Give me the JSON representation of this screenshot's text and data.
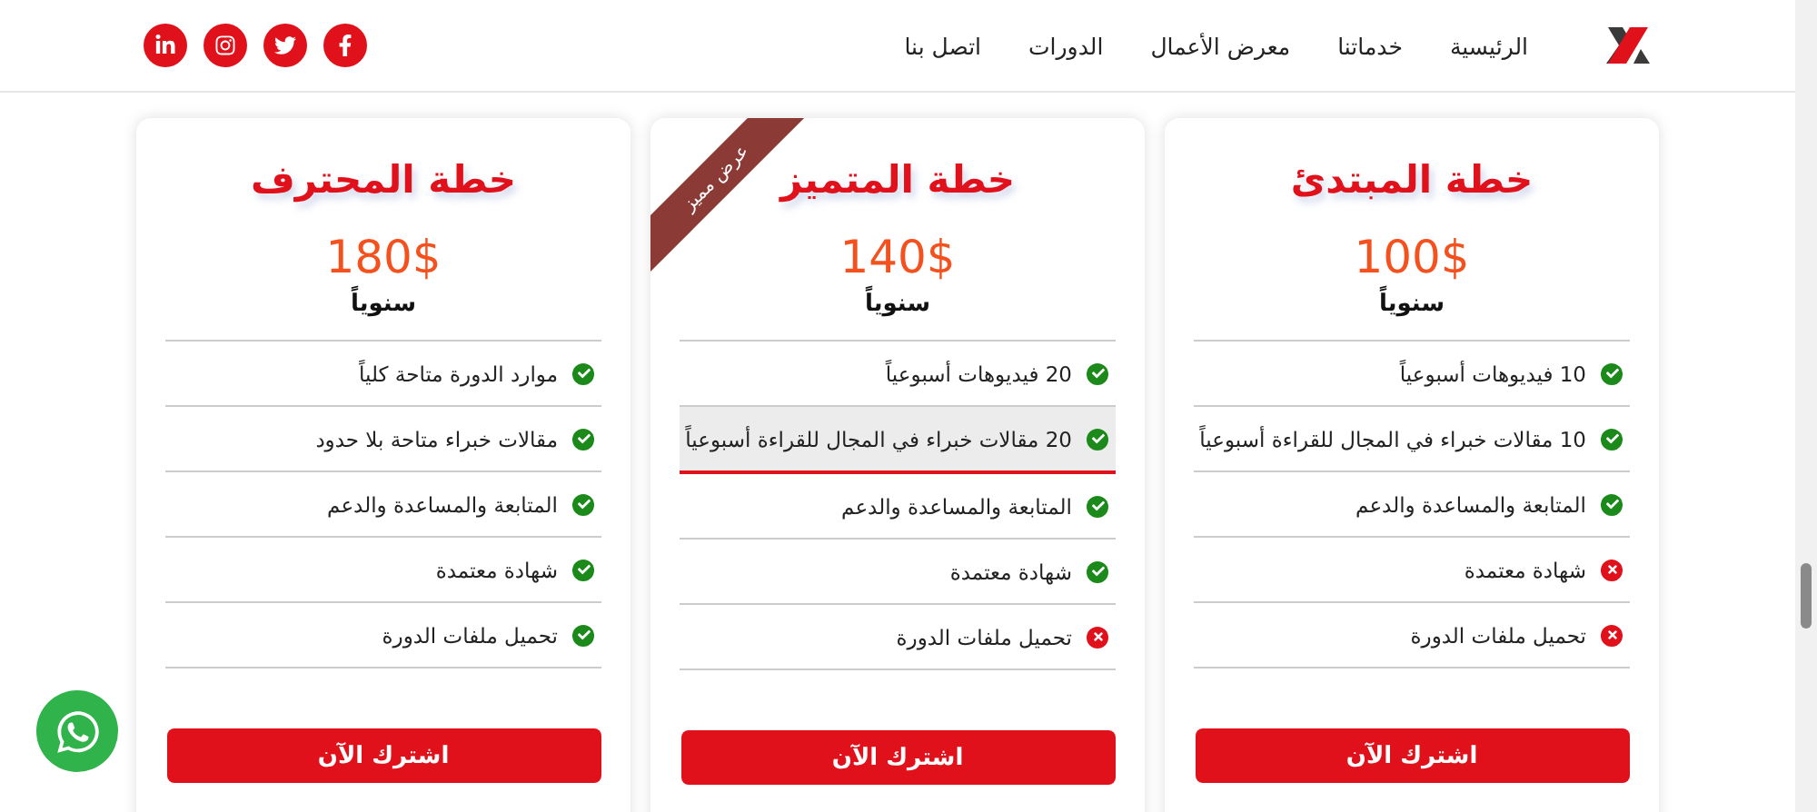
{
  "header": {
    "nav": [
      "الرئيسية",
      "خدماتنا",
      "معرض الأعمال",
      "الدورات",
      "اتصل بنا"
    ],
    "social": [
      {
        "kind": "facebook"
      },
      {
        "kind": "twitter"
      },
      {
        "kind": "instagram"
      },
      {
        "kind": "linkedin"
      }
    ]
  },
  "plans": [
    {
      "title": "خطة المبتدئ",
      "price": "100$",
      "period": "سنوياً",
      "features": [
        {
          "text": "10 فيديوهات أسبوعياً",
          "included": true,
          "highlighted": false
        },
        {
          "text": "10 مقالات خبراء في المجال للقراءة أسبوعياً",
          "included": true,
          "highlighted": false
        },
        {
          "text": "المتابعة والمساعدة والدعم",
          "included": true,
          "highlighted": false
        },
        {
          "text": "شهادة معتمدة",
          "included": false,
          "highlighted": false
        },
        {
          "text": "تحميل ملفات الدورة",
          "included": false,
          "highlighted": false
        }
      ],
      "button": "اشترك الآن"
    },
    {
      "title": "خطة المتميز",
      "ribbon": "عرض مميز",
      "price": "140$",
      "period": "سنوياً",
      "features": [
        {
          "text": "20 فيديوهات أسبوعياً",
          "included": true,
          "highlighted": false
        },
        {
          "text": "20 مقالات خبراء في المجال للقراءة أسبوعياً",
          "included": true,
          "highlighted": true
        },
        {
          "text": "المتابعة والمساعدة والدعم",
          "included": true,
          "highlighted": false
        },
        {
          "text": "شهادة معتمدة",
          "included": true,
          "highlighted": false
        },
        {
          "text": "تحميل ملفات الدورة",
          "included": false,
          "highlighted": false
        }
      ],
      "button": "اشترك الآن"
    },
    {
      "title": "خطة المحترف",
      "price": "180$",
      "period": "سنوياً",
      "features": [
        {
          "text": "موارد الدورة متاحة كلياً",
          "included": true,
          "highlighted": false
        },
        {
          "text": "مقالات خبراء متاحة بلا حدود",
          "included": true,
          "highlighted": false
        },
        {
          "text": "المتابعة والمساعدة والدعم",
          "included": true,
          "highlighted": false
        },
        {
          "text": "شهادة معتمدة",
          "included": true,
          "highlighted": false
        },
        {
          "text": "تحميل ملفات الدورة",
          "included": true,
          "highlighted": false
        }
      ],
      "button": "اشترك الآن"
    }
  ]
}
